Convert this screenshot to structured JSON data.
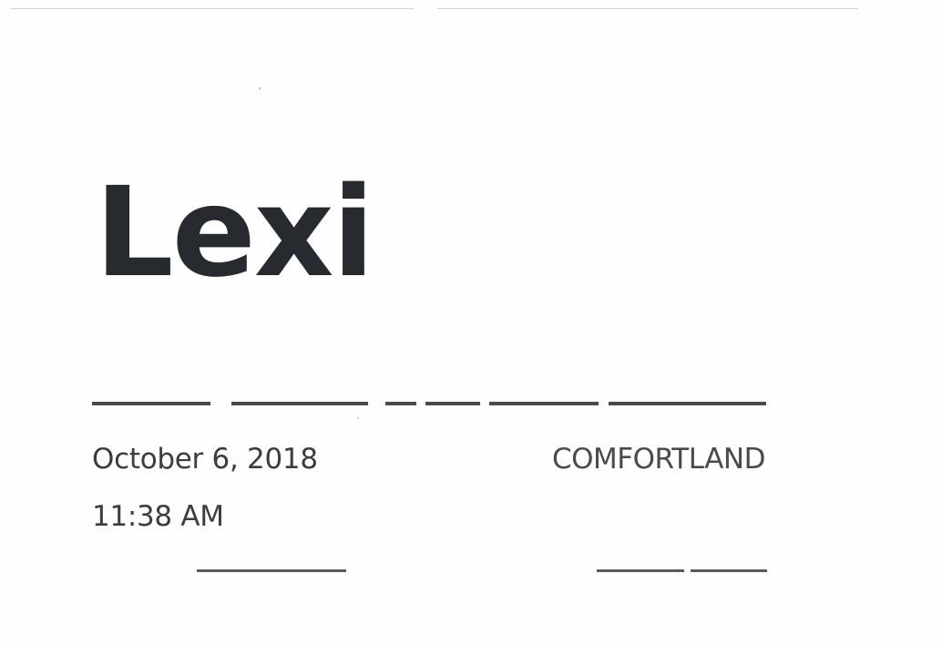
{
  "ticket": {
    "name": "Lexi",
    "date": "October 6, 2018",
    "time": "11:38 AM",
    "venue": "COMFORTLAND"
  }
}
